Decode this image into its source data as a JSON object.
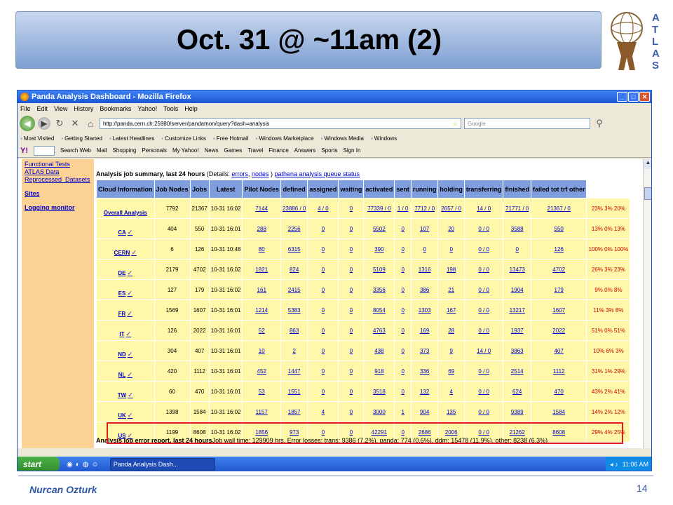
{
  "slide": {
    "title": "Oct. 31 @ ~11am (2)",
    "logo_letters": [
      "A",
      "T",
      "L",
      "A",
      "S"
    ],
    "footer_author": "Nurcan Ozturk",
    "page_number": "14",
    "colors": {
      "banner": "#7e9fd3",
      "footer": "#2f55a4",
      "highlight": "#e41b1b"
    }
  },
  "browser": {
    "window_title": "Panda Analysis Dashboard - Mozilla Firefox",
    "menu": [
      "File",
      "Edit",
      "View",
      "History",
      "Bookmarks",
      "Yahoo!",
      "Tools",
      "Help"
    ],
    "url": "http://panda.cern.ch:25980/server/pandamon/query?dash=analysis",
    "search_placeholder": "Google",
    "bookmarks": [
      "Most Visited",
      "Getting Started",
      "Latest Headlines",
      "Customize Links",
      "Free Hotmail",
      "Windows Marketplace",
      "Windows Media",
      "Windows"
    ],
    "yahoo_toolbar": [
      "Search Web",
      "Mail",
      "Shopping",
      "Personals",
      "My Yahoo!",
      "News",
      "Games",
      "Travel",
      "Finance",
      "Answers",
      "Sports",
      "Sign In"
    ]
  },
  "sidebar": {
    "links": [
      "Functional Tests",
      "ATLAS Data",
      "Reprocessed_Datasets"
    ],
    "bold_links": [
      "Sites",
      "Logging monitor"
    ]
  },
  "summary": {
    "heading_bold": "Analysis job summary, last 24 hours",
    "details_prefix": " (Details: ",
    "link_errors": "errors",
    "sep": ", ",
    "link_nodes": "nodes",
    "details_suffix": " ) ",
    "link_queue": "pathena analysis queue status",
    "columns": [
      "Cloud Information",
      "Job Nodes",
      "Jobs",
      "Latest",
      "Pilot Nodes",
      "defined",
      "assigned",
      "waiting",
      "activated",
      "sent",
      "running",
      "holding",
      "transferring",
      "finished",
      "failed tot trf other"
    ],
    "rows": [
      {
        "cloud": "Overall Analysis",
        "nodes": "7792",
        "jobs": "21367",
        "latest": "10-31 16:02",
        "pilot": "7144",
        "defined": "23886 / 0",
        "assigned": "4 / 0",
        "waiting": "0",
        "activated": "77339 / 0",
        "sent": "1 / 0",
        "running": "7712 / 0",
        "holding": "2657 / 0",
        "transferring": "14 / 0",
        "finished": "71771 / 0",
        "failed": "21367 / 0",
        "pct": "23% 3% 20%"
      },
      {
        "cloud": "CA",
        "nodes": "404",
        "jobs": "550",
        "latest": "10-31 16:01",
        "pilot": "288",
        "defined": "2256",
        "assigned": "0",
        "waiting": "0",
        "activated": "5502",
        "sent": "0",
        "running": "107",
        "holding": "20",
        "transferring": "0 / 0",
        "finished": "3588",
        "failed": "550",
        "pct": "13% 0% 13%"
      },
      {
        "cloud": "CERN",
        "nodes": "6",
        "jobs": "126",
        "latest": "10-31 10:48",
        "pilot": "80",
        "defined": "6315",
        "assigned": "0",
        "waiting": "0",
        "activated": "390",
        "sent": "0",
        "running": "0",
        "holding": "0",
        "transferring": "0 / 0",
        "finished": "0",
        "failed": "126",
        "pct": "100% 0% 100%"
      },
      {
        "cloud": "DE",
        "nodes": "2179",
        "jobs": "4702",
        "latest": "10-31 16:02",
        "pilot": "1821",
        "defined": "824",
        "assigned": "0",
        "waiting": "0",
        "activated": "5109",
        "sent": "0",
        "running": "1316",
        "holding": "198",
        "transferring": "0 / 0",
        "finished": "13473",
        "failed": "4702",
        "pct": "26% 3% 23%"
      },
      {
        "cloud": "ES",
        "nodes": "127",
        "jobs": "179",
        "latest": "10-31 16:02",
        "pilot": "161",
        "defined": "2415",
        "assigned": "0",
        "waiting": "0",
        "activated": "3356",
        "sent": "0",
        "running": "386",
        "holding": "21",
        "transferring": "0 / 0",
        "finished": "1904",
        "failed": "179",
        "pct": "9% 0% 8%"
      },
      {
        "cloud": "FR",
        "nodes": "1569",
        "jobs": "1607",
        "latest": "10-31 16:01",
        "pilot": "1214",
        "defined": "5383",
        "assigned": "0",
        "waiting": "0",
        "activated": "8054",
        "sent": "0",
        "running": "1303",
        "holding": "167",
        "transferring": "0 / 0",
        "finished": "13217",
        "failed": "1607",
        "pct": "11% 3% 8%"
      },
      {
        "cloud": "IT",
        "nodes": "126",
        "jobs": "2022",
        "latest": "10-31 16:01",
        "pilot": "52",
        "defined": "863",
        "assigned": "0",
        "waiting": "0",
        "activated": "4763",
        "sent": "0",
        "running": "169",
        "holding": "28",
        "transferring": "0 / 0",
        "finished": "1937",
        "failed": "2022",
        "pct": "51% 0% 51%"
      },
      {
        "cloud": "ND",
        "nodes": "304",
        "jobs": "407",
        "latest": "10-31 16:01",
        "pilot": "10",
        "defined": "2",
        "assigned": "0",
        "waiting": "0",
        "activated": "438",
        "sent": "0",
        "running": "373",
        "holding": "9",
        "transferring": "14 / 0",
        "finished": "3863",
        "failed": "407",
        "pct": "10% 6% 3%"
      },
      {
        "cloud": "NL",
        "nodes": "420",
        "jobs": "1112",
        "latest": "10-31 16:01",
        "pilot": "452",
        "defined": "1447",
        "assigned": "0",
        "waiting": "0",
        "activated": "918",
        "sent": "0",
        "running": "336",
        "holding": "69",
        "transferring": "0 / 0",
        "finished": "2514",
        "failed": "1112",
        "pct": "31% 1% 29%"
      },
      {
        "cloud": "TW",
        "nodes": "60",
        "jobs": "470",
        "latest": "10-31 16:01",
        "pilot": "53",
        "defined": "1551",
        "assigned": "0",
        "waiting": "0",
        "activated": "3518",
        "sent": "0",
        "running": "132",
        "holding": "4",
        "transferring": "0 / 0",
        "finished": "624",
        "failed": "470",
        "pct": "43% 2% 41%"
      },
      {
        "cloud": "UK",
        "nodes": "1398",
        "jobs": "1584",
        "latest": "10-31 16:02",
        "pilot": "1157",
        "defined": "1857",
        "assigned": "4",
        "waiting": "0",
        "activated": "3000",
        "sent": "1",
        "running": "904",
        "holding": "135",
        "transferring": "0 / 0",
        "finished": "9389",
        "failed": "1584",
        "pct": "14% 2% 12%"
      },
      {
        "cloud": "US",
        "nodes": "1199",
        "jobs": "8608",
        "latest": "10-31 16:02",
        "pilot": "1856",
        "defined": "973",
        "assigned": "0",
        "waiting": "0",
        "activated": "42291",
        "sent": "0",
        "running": "2686",
        "holding": "2006",
        "transferring": "0 / 0",
        "finished": "21262",
        "failed": "8608",
        "pct": "29% 4% 25%"
      }
    ]
  },
  "error_report": {
    "bold": "Analysis job error report, last 24 hours",
    "text": "Job wall time: 129909 hrs. Error losses: trans: 9386 (7.2%), panda: 774 (0.6%), ddm: 15478 (11.9%), other: 8238 (6.3%)"
  },
  "taskbar": {
    "start": "start",
    "task": "Panda Analysis Dash...",
    "clock": "11:06 AM"
  }
}
